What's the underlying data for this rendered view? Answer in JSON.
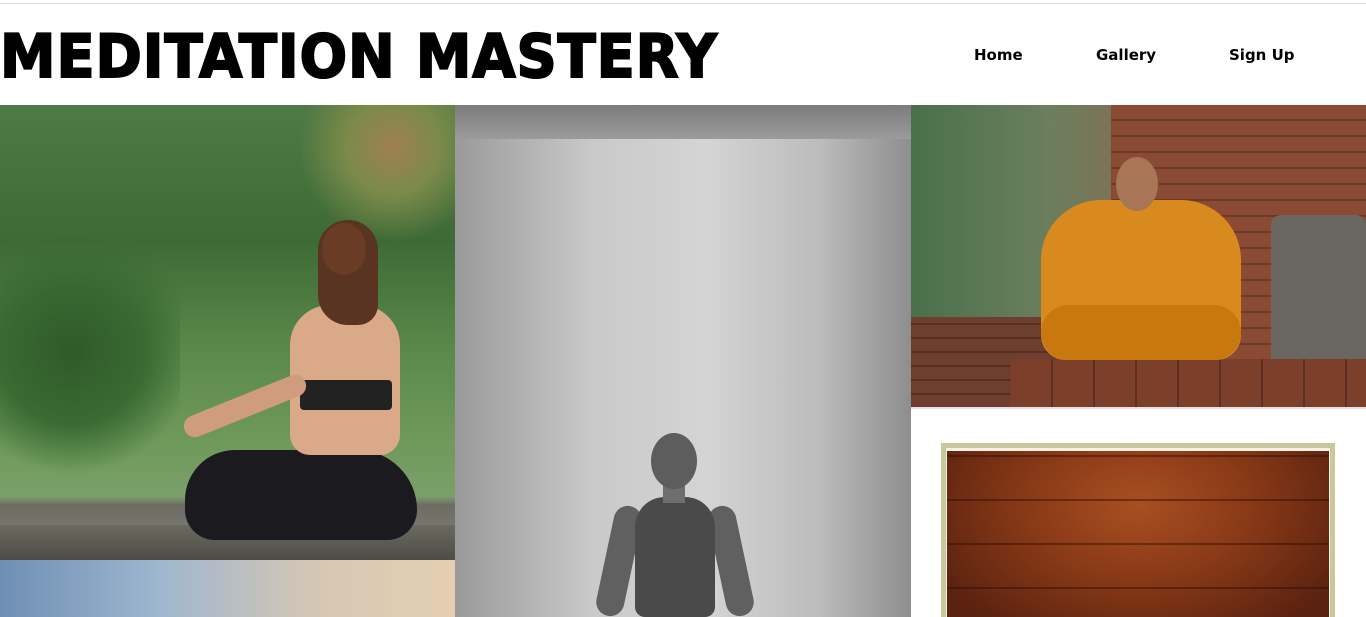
{
  "header": {
    "title": "MEDITATION MASTERY"
  },
  "nav": {
    "items": [
      {
        "label": "Home"
      },
      {
        "label": "Gallery"
      },
      {
        "label": "Sign Up"
      }
    ]
  },
  "gallery": {
    "images": [
      {
        "subject": "woman meditating in forest"
      },
      {
        "subject": "woman meditating black and white"
      },
      {
        "subject": "monk in orange robe meditating"
      },
      {
        "subject": "framed wooden panel"
      },
      {
        "subject": "sky"
      }
    ]
  }
}
